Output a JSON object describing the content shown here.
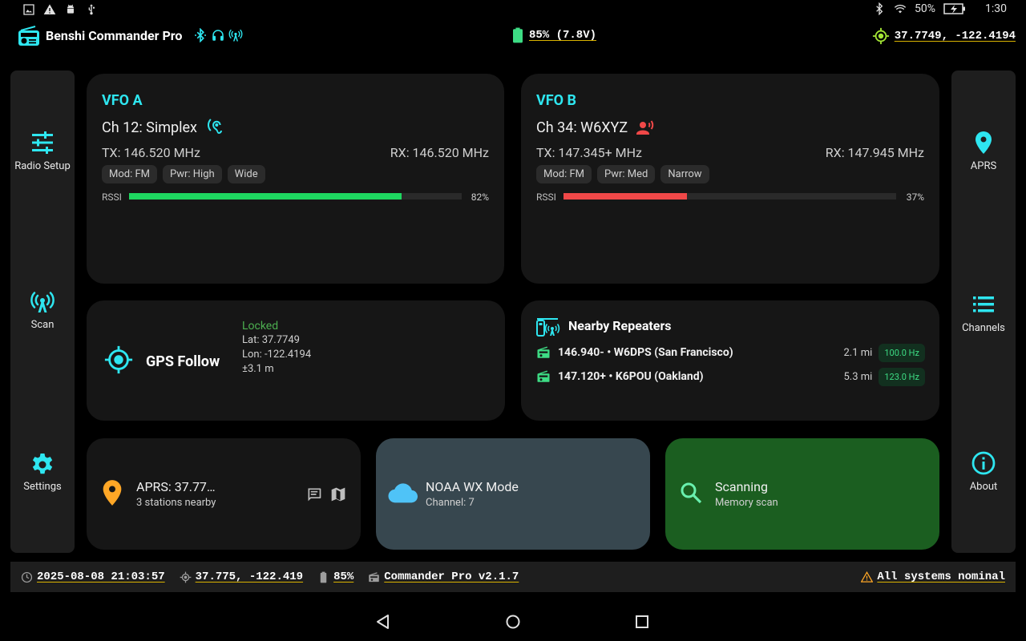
{
  "status_bar": {
    "battery_pct": "50%",
    "time": "1:30"
  },
  "app": {
    "title": "Benshi Commander Pro",
    "battery": "85% (7.8V)",
    "gps": "37.7749, -122.4194"
  },
  "left_rail": [
    {
      "label": "Radio Setup",
      "icon": "tune-icon"
    },
    {
      "label": "Scan",
      "icon": "scan-icon"
    },
    {
      "label": "Settings",
      "icon": "gear-icon"
    }
  ],
  "right_rail": [
    {
      "label": "APRS",
      "icon": "location-pin-icon"
    },
    {
      "label": "Channels",
      "icon": "list-icon"
    },
    {
      "label": "About",
      "icon": "info-icon"
    }
  ],
  "vfo_a": {
    "title": "VFO A",
    "channel": "Ch 12: Simplex",
    "tx": "TX: 146.520 MHz",
    "rx": "RX: 146.520 MHz",
    "chips": [
      "Mod: FM",
      "Pwr: High",
      "Wide"
    ],
    "rssi_label": "RSSI",
    "rssi_value": 82,
    "rssi_text": "82%",
    "bar_color": "#1ed760"
  },
  "vfo_b": {
    "title": "VFO B",
    "channel": "Ch 34: W6XYZ",
    "tx": "TX: 147.345+ MHz",
    "rx": "RX: 147.945 MHz",
    "chips": [
      "Mod: FM",
      "Pwr: Med",
      "Narrow"
    ],
    "rssi_label": "RSSI",
    "rssi_value": 37,
    "rssi_text": "37%",
    "bar_color": "#f04848"
  },
  "gps_card": {
    "label": "GPS Follow",
    "status": "Locked",
    "lat": "Lat: 37.7749",
    "lon": "Lon: -122.4194",
    "accuracy": "±3.1 m"
  },
  "repeaters": {
    "title": "Nearby Repeaters",
    "items": [
      {
        "name": "146.940- • W6DPS (San Francisco)",
        "dist": "2.1 mi",
        "tone": "100.0 Hz"
      },
      {
        "name": "147.120+ • K6POU (Oakland)",
        "dist": "5.3 mi",
        "tone": "123.0 Hz"
      }
    ]
  },
  "aprs_card": {
    "title": "APRS: 37.77…",
    "sub": "3 stations nearby"
  },
  "noaa_card": {
    "title": "NOAA WX Mode",
    "sub": "Channel: 7",
    "bg": "#37474f"
  },
  "scan_card": {
    "title": "Scanning",
    "sub": "Memory scan",
    "bg": "#1b5e20"
  },
  "footer": {
    "datetime": "2025-08-08 21:03:57",
    "coords": "37.775, -122.419",
    "battery": "85%",
    "version": "Commander Pro v2.1.7",
    "status": "All systems nominal"
  },
  "colors": {
    "accent": "#2ee6f0",
    "warning": "#ffa726",
    "gps": "#a4e635"
  }
}
